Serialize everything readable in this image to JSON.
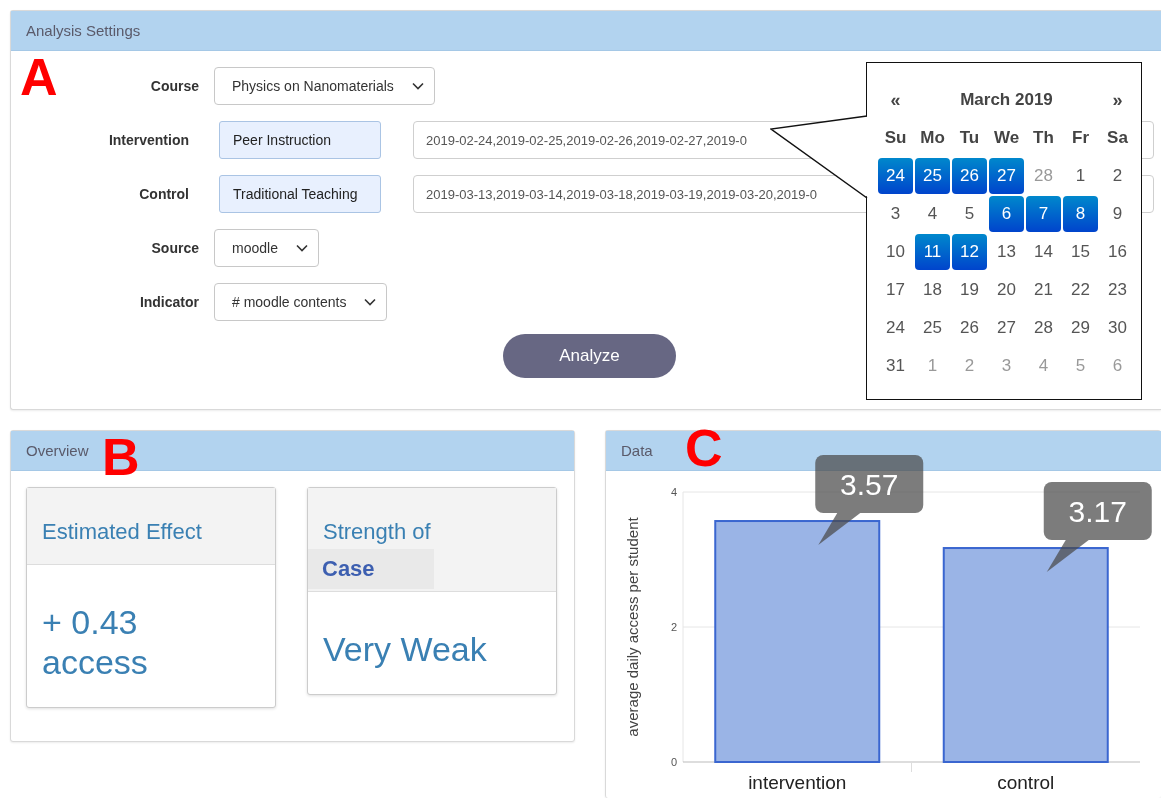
{
  "settings": {
    "title": "Analysis Settings",
    "marker": "A",
    "fields": [
      {
        "kind": "select",
        "label": "Course",
        "value": "Physics on Nanomaterials"
      },
      {
        "kind": "group",
        "label": "Intervention",
        "name": "Peer Instruction",
        "dates": "2019-02-24,2019-02-25,2019-02-26,2019-02-27,2019-0"
      },
      {
        "kind": "group",
        "label": "Control",
        "name": "Traditional Teaching",
        "dates": "2019-03-13,2019-03-14,2019-03-18,2019-03-19,2019-03-20,2019-0"
      },
      {
        "kind": "select",
        "label": "Source",
        "value": "moodle"
      },
      {
        "kind": "select",
        "label": "Indicator",
        "value": "# moodle contents"
      }
    ],
    "analyze_button": "Analyze",
    "calendar": {
      "prev": "«",
      "title": "March 2019",
      "next": "»",
      "weekdays": [
        "Su",
        "Mo",
        "Tu",
        "We",
        "Th",
        "Fr",
        "Sa"
      ],
      "days": [
        {
          "label": "24",
          "selected": true,
          "other_month": true
        },
        {
          "label": "25",
          "selected": true,
          "other_month": true
        },
        {
          "label": "26",
          "selected": true,
          "other_month": true
        },
        {
          "label": "27",
          "selected": true,
          "other_month": true
        },
        {
          "label": "28",
          "selected": false,
          "other_month": true
        },
        {
          "label": "1",
          "selected": false,
          "other_month": false
        },
        {
          "label": "2",
          "selected": false,
          "other_month": false
        },
        {
          "label": "3",
          "selected": false,
          "other_month": false
        },
        {
          "label": "4",
          "selected": false,
          "other_month": false
        },
        {
          "label": "5",
          "selected": false,
          "other_month": false
        },
        {
          "label": "6",
          "selected": true,
          "other_month": false
        },
        {
          "label": "7",
          "selected": true,
          "other_month": false
        },
        {
          "label": "8",
          "selected": true,
          "other_month": false
        },
        {
          "label": "9",
          "selected": false,
          "other_month": false
        },
        {
          "label": "10",
          "selected": false,
          "other_month": false
        },
        {
          "label": "11",
          "selected": true,
          "other_month": false
        },
        {
          "label": "12",
          "selected": true,
          "other_month": false
        },
        {
          "label": "13",
          "selected": false,
          "other_month": false
        },
        {
          "label": "14",
          "selected": false,
          "other_month": false
        },
        {
          "label": "15",
          "selected": false,
          "other_month": false
        },
        {
          "label": "16",
          "selected": false,
          "other_month": false
        },
        {
          "label": "17",
          "selected": false,
          "other_month": false
        },
        {
          "label": "18",
          "selected": false,
          "other_month": false
        },
        {
          "label": "19",
          "selected": false,
          "other_month": false
        },
        {
          "label": "20",
          "selected": false,
          "other_month": false
        },
        {
          "label": "21",
          "selected": false,
          "other_month": false
        },
        {
          "label": "22",
          "selected": false,
          "other_month": false
        },
        {
          "label": "23",
          "selected": false,
          "other_month": false
        },
        {
          "label": "24",
          "selected": false,
          "other_month": false
        },
        {
          "label": "25",
          "selected": false,
          "other_month": false
        },
        {
          "label": "26",
          "selected": false,
          "other_month": false
        },
        {
          "label": "27",
          "selected": false,
          "other_month": false
        },
        {
          "label": "28",
          "selected": false,
          "other_month": false
        },
        {
          "label": "29",
          "selected": false,
          "other_month": false
        },
        {
          "label": "30",
          "selected": false,
          "other_month": false
        },
        {
          "label": "31",
          "selected": false,
          "other_month": false
        },
        {
          "label": "1",
          "selected": false,
          "other_month": true
        },
        {
          "label": "2",
          "selected": false,
          "other_month": true
        },
        {
          "label": "3",
          "selected": false,
          "other_month": true
        },
        {
          "label": "4",
          "selected": false,
          "other_month": true
        },
        {
          "label": "5",
          "selected": false,
          "other_month": true
        },
        {
          "label": "6",
          "selected": false,
          "other_month": true
        }
      ]
    }
  },
  "overview": {
    "title": "Overview",
    "marker": "B",
    "cards": [
      {
        "title": "Estimated Effect",
        "value": "+ 0.43 access"
      },
      {
        "title": "Strength of",
        "subtitle": "Case",
        "value": "Very Weak"
      }
    ]
  },
  "data": {
    "title": "Data",
    "marker": "C",
    "chart_data": {
      "type": "bar",
      "ylabel": "average daily access per student",
      "categories": [
        "intervention",
        "control"
      ],
      "series": [
        {
          "color": "#9ab4e6",
          "values": [
            3.57,
            3.17
          ]
        }
      ],
      "ylim": [
        0,
        4
      ],
      "yticks": [
        0,
        2,
        4
      ],
      "value_labels": [
        "3.57",
        "3.17"
      ]
    }
  }
}
